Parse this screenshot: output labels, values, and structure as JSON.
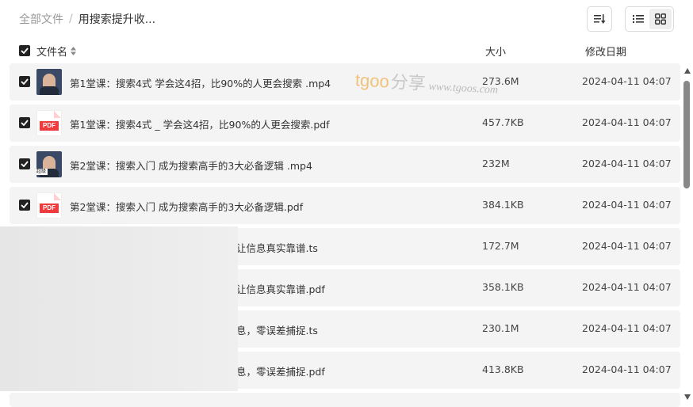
{
  "breadcrumb": {
    "root": "全部文件",
    "separator": "/",
    "current": "用搜索提升收..."
  },
  "columns": {
    "name": "文件名",
    "size": "大小",
    "date": "修改日期"
  },
  "watermark": {
    "brand": "tgoo",
    "cn": "分享",
    "url": "www.tgoos.com"
  },
  "files": [
    {
      "name": "第1堂课：搜索4式  学会这4招，比90%的人更会搜索 .mp4",
      "size": "273.6M",
      "date": "2024-04-11 04:07",
      "type": "video",
      "checked": true,
      "thumb_tag": ""
    },
    {
      "name": "第1堂课：搜索4式  _ 学会这4招，比90%的人更会搜索.pdf",
      "size": "457.7KB",
      "date": "2024-04-11 04:07",
      "type": "pdf",
      "checked": true,
      "thumb_tag": "PDF"
    },
    {
      "name": "第2堂课：搜索入门  成为搜索高手的3大必备逻辑 .mp4",
      "size": "232M",
      "date": "2024-04-11 04:07",
      "type": "video",
      "checked": true,
      "thumb_tag": "超级"
    },
    {
      "name": "第2堂课：搜索入门  成为搜索高手的3大必备逻辑.pdf",
      "size": "384.1KB",
      "date": "2024-04-11 04:07",
      "type": "pdf",
      "checked": true,
      "thumb_tag": "PDF"
    },
    {
      "name": "让信息真实靠谱.ts",
      "size": "172.7M",
      "date": "2024-04-11 04:07",
      "type": "obscured",
      "checked": false,
      "thumb_tag": ""
    },
    {
      "name": "让信息真实靠谱.pdf",
      "size": "358.1KB",
      "date": "2024-04-11 04:07",
      "type": "obscured",
      "checked": false,
      "thumb_tag": ""
    },
    {
      "name": "息，零误差捕捉.ts",
      "size": "230.1M",
      "date": "2024-04-11 04:07",
      "type": "obscured",
      "checked": false,
      "thumb_tag": ""
    },
    {
      "name": "息，零误差捕捉.pdf",
      "size": "413.8KB",
      "date": "2024-04-11 04:07",
      "type": "obscured",
      "checked": false,
      "thumb_tag": ""
    }
  ]
}
